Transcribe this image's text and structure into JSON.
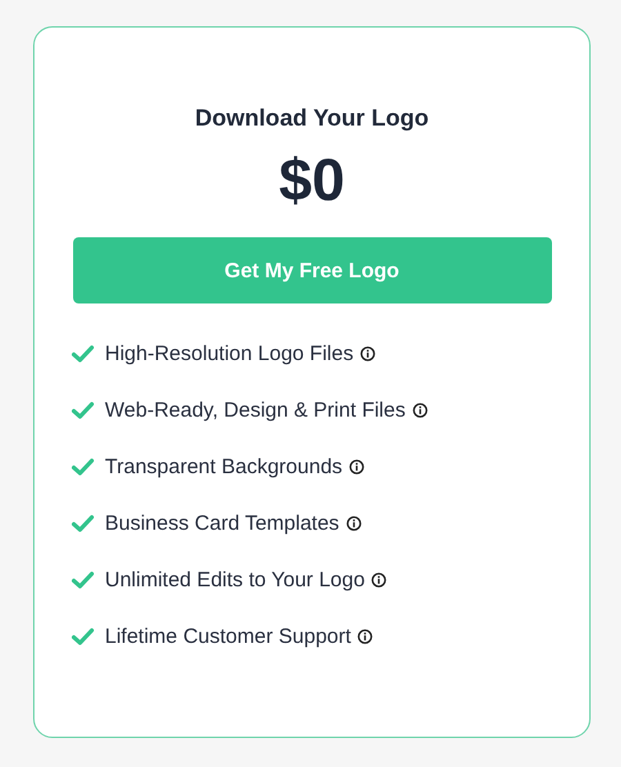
{
  "card": {
    "title": "Download Your Logo",
    "price": "$0",
    "button": "Get My Free Logo",
    "features": [
      "High-Resolution Logo Files",
      "Web-Ready, Design & Print Files",
      "Transparent Backgrounds",
      "Business Card Templates",
      "Unlimited Edits to Your Logo",
      "Lifetime Customer Support"
    ]
  }
}
